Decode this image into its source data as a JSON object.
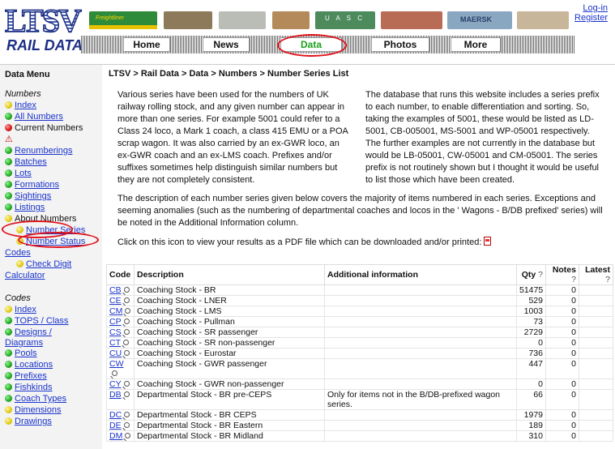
{
  "header": {
    "logo_mark": "LTSV",
    "logo_sub": "RAIL DATA",
    "login": "Log-in",
    "register": "Register",
    "nav": [
      "Home",
      "News",
      "Data",
      "Photos",
      "More"
    ],
    "active_nav": "Data",
    "train_livery_texts": [
      "Freightliner",
      "U A S C",
      "MAERSK"
    ]
  },
  "sidebar": {
    "title": "Data Menu",
    "numbers_heading": "Numbers",
    "numbers_items": [
      {
        "label": "Index",
        "dot": "yellow"
      },
      {
        "label": "All Numbers",
        "dot": "green"
      },
      {
        "label": "Current Numbers",
        "dot": "red"
      },
      {
        "label": "Renumberings",
        "dot": "green"
      },
      {
        "label": "Batches",
        "dot": "green"
      },
      {
        "label": "Lots",
        "dot": "green"
      },
      {
        "label": "Formations",
        "dot": "green"
      },
      {
        "label": "Sightings",
        "dot": "green"
      },
      {
        "label": "Listings",
        "dot": "green"
      },
      {
        "label": "About Numbers",
        "dot": "yellow"
      }
    ],
    "about_sub": [
      {
        "label": "Number Series",
        "dot": "yellow"
      },
      {
        "label": "Number Status",
        "dot": "yellow"
      }
    ],
    "codes_link": "Codes",
    "check_digit": "Check Digit",
    "calculator": "Calculator",
    "codes_heading": "Codes",
    "codes_items": [
      {
        "label": "Index",
        "dot": "yellow"
      },
      {
        "label": "TOPS / Class",
        "dot": "green"
      },
      {
        "label": "Designs / Diagrams",
        "dot": "green"
      },
      {
        "label": "Pools",
        "dot": "green"
      },
      {
        "label": "Locations",
        "dot": "green"
      },
      {
        "label": "Prefixes",
        "dot": "green"
      },
      {
        "label": "Fishkinds",
        "dot": "green"
      },
      {
        "label": "Coach Types",
        "dot": "green"
      },
      {
        "label": "Dimensions",
        "dot": "yellow"
      },
      {
        "label": "Drawings",
        "dot": "yellow"
      }
    ],
    "warning_symbol": "⚠"
  },
  "main": {
    "breadcrumb": "LTSV > Rail Data > Data > Numbers > Number Series List",
    "para_left": "Various series have been used for the numbers of UK railway rolling stock, and any given number can appear in more than one series. For example 5001 could refer to a Class 24 loco, a Mark 1 coach, a class 415 EMU or a POA scrap wagon. It was also carried by an ex-GWR loco, an ex-GWR coach and an ex-LMS coach. Prefixes and/or suffixes sometimes help distinguish similar numbers but they are not completely consistent.",
    "para_right": "The database that runs this website includes a series prefix to each number, to enable differentiation and sorting. So, taking the examples of 5001, these would be listed as LD-5001, CB-005001, MS-5001 and WP-05001 respectively. The further examples are not currently in the database but would be LB-05001, CW-05001 and CM-05001. The series prefix is not routinely shown but I thought it would be useful to list those which have been created.",
    "para_desc": "The description of each number series given below covers the majority of items numbered in each series. Exceptions and seeming anomalies (such as the numbering of departmental coaches and locos in the ' Wagons - B/DB prefixed' series) will be noted in the Additional Information column.",
    "pdf_line": "Click on this icon to view your results as a PDF file which can be downloaded and/or printed:"
  },
  "table": {
    "headers": {
      "code": "Code",
      "description": "Description",
      "additional": "Additional information",
      "qty": "Qty",
      "notes": "Notes",
      "latest": "Latest",
      "q": "?"
    },
    "rows": [
      {
        "code": "CB",
        "description": "Coaching Stock - BR",
        "additional": "",
        "qty": "51475",
        "notes": "0"
      },
      {
        "code": "CE",
        "description": "Coaching Stock - LNER",
        "additional": "",
        "qty": "529",
        "notes": "0"
      },
      {
        "code": "CM",
        "description": "Coaching Stock - LMS",
        "additional": "",
        "qty": "1003",
        "notes": "0"
      },
      {
        "code": "CP",
        "description": "Coaching Stock - Pullman",
        "additional": "",
        "qty": "73",
        "notes": "0"
      },
      {
        "code": "CS",
        "description": "Coaching Stock - SR passenger",
        "additional": "",
        "qty": "2729",
        "notes": "0"
      },
      {
        "code": "CT",
        "description": "Coaching Stock - SR non-passenger",
        "additional": "",
        "qty": "0",
        "notes": "0"
      },
      {
        "code": "CU",
        "description": "Coaching Stock - Eurostar",
        "additional": "",
        "qty": "736",
        "notes": "0"
      },
      {
        "code": "CW",
        "description": "Coaching Stock - GWR passenger",
        "additional": "",
        "qty": "447",
        "notes": "0"
      },
      {
        "code": "CY",
        "description": "Coaching Stock - GWR non-passenger",
        "additional": "",
        "qty": "0",
        "notes": "0"
      },
      {
        "code": "DB",
        "description": "Departmental Stock - BR pre-CEPS",
        "additional": "Only for items not in the B/DB-prefixed wagon series.",
        "qty": "66",
        "notes": "0"
      },
      {
        "code": "DC",
        "description": "Departmental Stock - BR CEPS",
        "additional": "",
        "qty": "1979",
        "notes": "0"
      },
      {
        "code": "DE",
        "description": "Departmental Stock - BR Eastern",
        "additional": "",
        "qty": "189",
        "notes": "0"
      },
      {
        "code": "DM",
        "description": "Departmental Stock - BR Midland",
        "additional": "",
        "qty": "310",
        "notes": "0"
      }
    ]
  },
  "colors": {
    "link": "#1a33cc",
    "active_nav": "#1aa01a",
    "highlight_ring": "#e0121b",
    "sidebar_bg": "#f3f3f3"
  }
}
